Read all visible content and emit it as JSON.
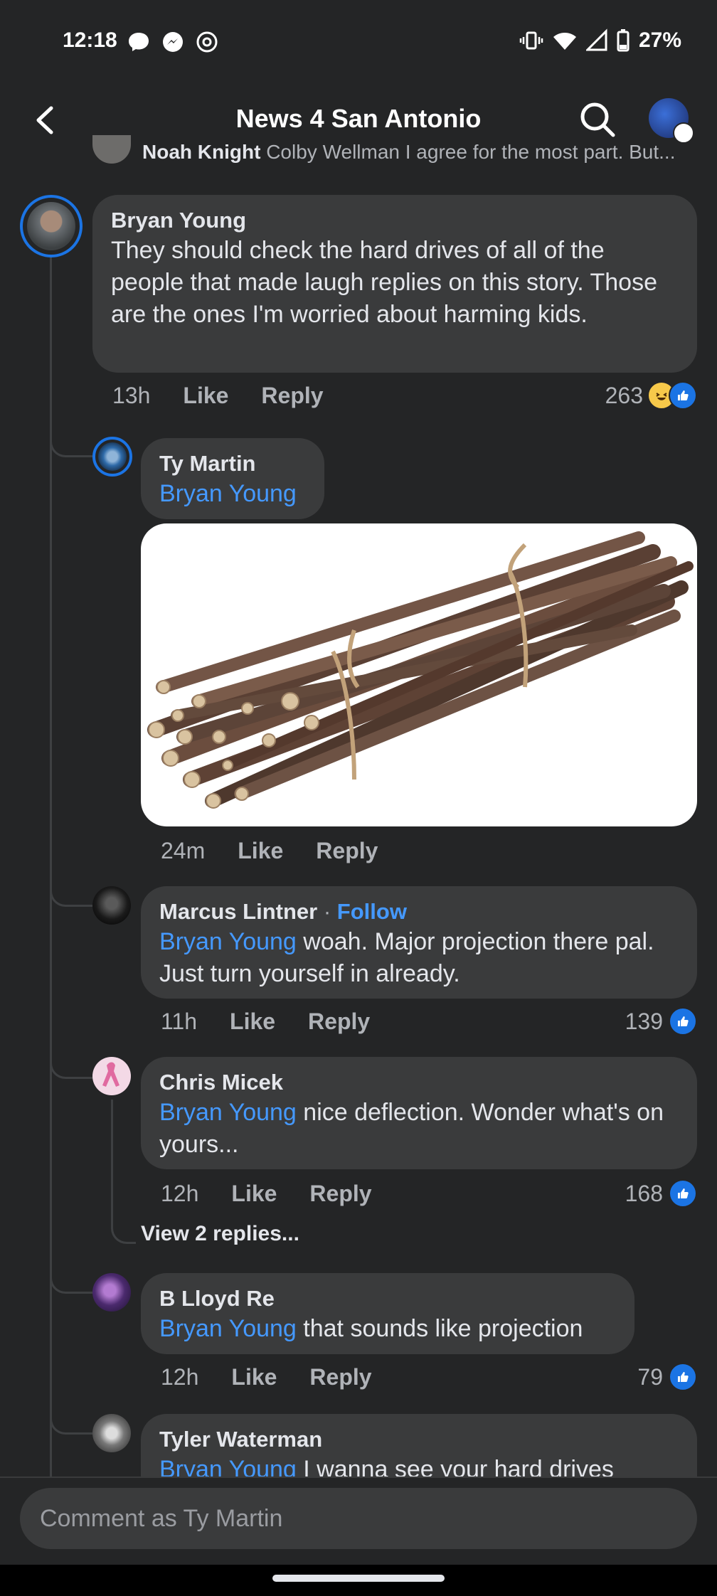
{
  "status_bar": {
    "time": "12:18",
    "battery": "27%"
  },
  "header": {
    "title": "News 4 San Antonio"
  },
  "previous_comment": {
    "name": "Noah Knight",
    "snippet": "Colby Wellman I agree for the most part. But..."
  },
  "comments": [
    {
      "name": "Bryan Young",
      "text": "They should check the hard drives of all of the people that made laugh replies on this story. Those are the ones I'm worried about harming kids.",
      "time": "13h",
      "like": "Like",
      "reply": "Reply",
      "reactions": "263"
    },
    {
      "name": "Ty Martin",
      "mention": "Bryan Young",
      "time": "24m",
      "like": "Like",
      "reply": "Reply"
    },
    {
      "name": "Marcus Lintner",
      "follow": "Follow",
      "mention": "Bryan Young",
      "text": " woah. Major projection there pal. Just turn yourself in already.",
      "time": "11h",
      "like": "Like",
      "reply": "Reply",
      "reactions": "139"
    },
    {
      "name": "Chris Micek",
      "mention": "Bryan Young",
      "text": " nice deflection. Wonder what's on yours...",
      "time": "12h",
      "like": "Like",
      "reply": "Reply",
      "reactions": "168",
      "view_replies": "View 2 replies..."
    },
    {
      "name": "B Lloyd Re",
      "mention": "Bryan Young",
      "text": " that sounds like projection",
      "time": "12h",
      "like": "Like",
      "reply": "Reply",
      "reactions": "79"
    },
    {
      "name": "Tyler Waterman",
      "mention": "Bryan Young",
      "text": " I wanna see your hard drives"
    }
  ],
  "composer": {
    "placeholder": "Comment as Ty Martin"
  },
  "colors": {
    "background": "#242526",
    "bubble": "#3a3b3c",
    "mention": "#4599ff",
    "like_blue": "#1b74e4"
  }
}
